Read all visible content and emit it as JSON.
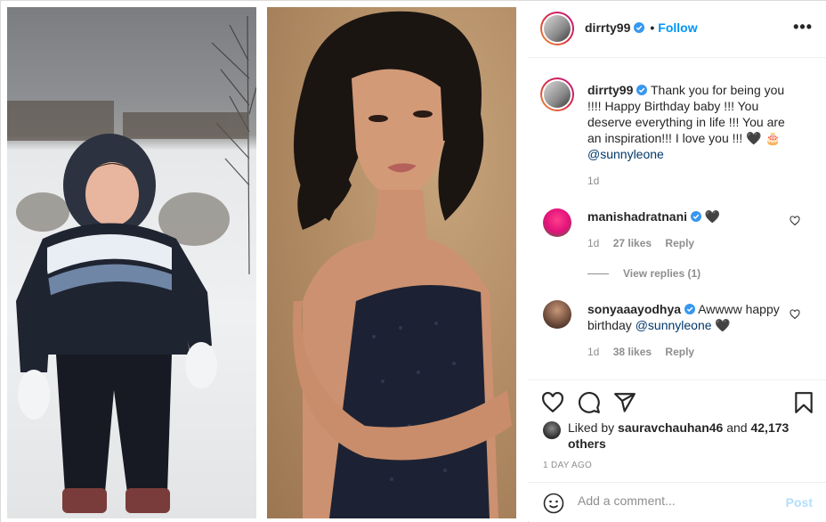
{
  "media": {
    "left_photo_alt": "Child in snowsuit standing in snow",
    "right_photo_alt": "Woman in sequined strapless dress"
  },
  "header": {
    "username": "dirrty99",
    "separator": "•",
    "follow_label": "Follow",
    "more_label": "•••"
  },
  "caption": {
    "username": "dirrty99",
    "text": "Thank you for being you !!!! Happy Birthday baby !!! You deserve everything in life !!! You are an inspiration!!! I love you !!! 🖤 🎂",
    "mention": "@sunnyleone",
    "time": "1d"
  },
  "comments": [
    {
      "username": "manishadratnani",
      "text": "🖤",
      "time": "1d",
      "likes": "27 likes",
      "reply": "Reply",
      "view_replies": "View replies (1)"
    },
    {
      "username": "sonyaaayodhya",
      "text": "Awwww happy birthday",
      "mention": "@sunnyleone",
      "text_suffix": "🖤",
      "time": "1d",
      "likes": "38 likes",
      "reply": "Reply"
    }
  ],
  "actions": {
    "like_icon": "heart-icon",
    "comment_icon": "comment-icon",
    "share_icon": "share-icon",
    "save_icon": "bookmark-icon"
  },
  "likes": {
    "prefix": "Liked by",
    "user": "sauravchauhan46",
    "and": "and",
    "count": "42,173 others"
  },
  "date": "1 DAY AGO",
  "add_comment": {
    "placeholder": "Add a comment...",
    "post_label": "Post"
  },
  "colors": {
    "accent": "#0095f6",
    "post_disabled": "#b2dffc",
    "muted": "#8e8e8e",
    "verified": "#3897f0"
  }
}
